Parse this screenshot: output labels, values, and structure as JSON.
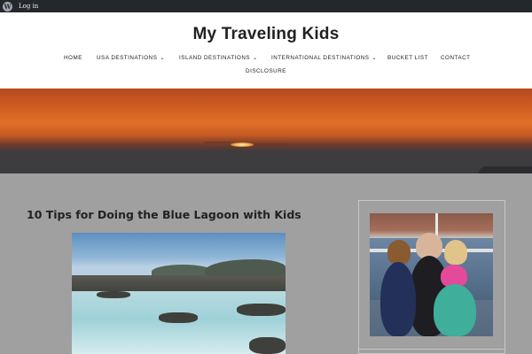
{
  "admin_bar": {
    "logo_icon": "wordpress-logo-icon",
    "login_label": "Log in"
  },
  "site": {
    "title": "My Traveling Kids"
  },
  "nav": {
    "items": [
      {
        "label": "HOME",
        "dropdown": false
      },
      {
        "label": "USA DESTINATIONS",
        "dropdown": true
      },
      {
        "label": "ISLAND DESTINATIONS",
        "dropdown": true
      },
      {
        "label": "INTERNATIONAL DESTINATIONS",
        "dropdown": true
      },
      {
        "label": "BUCKET LIST",
        "dropdown": false
      },
      {
        "label": "CONTACT",
        "dropdown": false
      }
    ],
    "second_row": [
      {
        "label": "DISCLOSURE",
        "dropdown": false
      }
    ],
    "dropdown_icon": "chevron-down-icon"
  },
  "hero": {
    "image": "sunset-over-sea-banner"
  },
  "post": {
    "title": "10 Tips for Doing the Blue Lagoon with Kids",
    "image": "blue-lagoon-photo"
  },
  "sidebar": {
    "image": "family-on-boat-photo"
  },
  "colors": {
    "admin_bar": "#23282d",
    "header_bg": "#ffffff",
    "page_bg": "#a0a0a0",
    "title_text": "#222222"
  }
}
